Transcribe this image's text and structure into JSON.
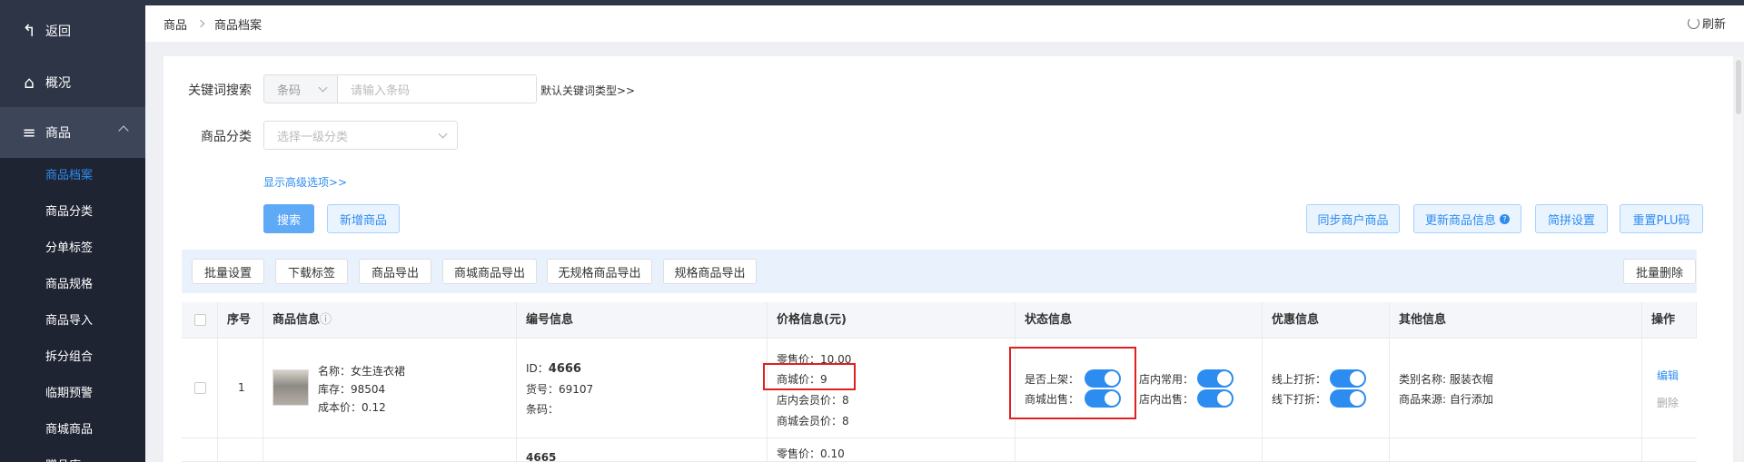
{
  "sidebar": {
    "back": "返回",
    "overview": "概况",
    "goods": "商品",
    "sub_items": [
      "商品档案",
      "商品分类",
      "分单标签",
      "商品规格",
      "商品导入",
      "拆分组合",
      "临期预警",
      "商城商品",
      "赠品库"
    ]
  },
  "breadcrumb": {
    "root": "商品",
    "current": "商品档案"
  },
  "refresh_label": "刷新",
  "search": {
    "keyword_label": "关键词搜索",
    "keyword_type": "条码",
    "keyword_placeholder": "请输入条码",
    "default_type_link": "默认关键词类型>>",
    "category_label": "商品分类",
    "category_placeholder": "选择一级分类",
    "advanced_link": "显示高级选项>>",
    "search_btn": "搜索",
    "add_btn": "新增商品"
  },
  "right_buttons": [
    "同步商户商品",
    "更新商品信息",
    "简拼设置",
    "重置PLU码"
  ],
  "toolbar": {
    "buttons": [
      "批量设置",
      "下载标签",
      "商品导出",
      "商城商品导出",
      "无规格商品导出",
      "规格商品导出"
    ],
    "batch_delete": "批量删除"
  },
  "table": {
    "headers": [
      "序号",
      "商品信息",
      "编号信息",
      "价格信息(元)",
      "状态信息",
      "优惠信息",
      "其他信息",
      "操作"
    ],
    "info_icon": "ⓘ",
    "rows": [
      {
        "index": "1",
        "name": "名称：女生连衣裙",
        "stock": "库存：98504",
        "cost": "成本价：0.12",
        "id_label": "ID：",
        "id_value": "4666",
        "sku": "货号：69107",
        "barcode": "条码：",
        "retail": "零售价：10.00",
        "mall": "商城价：9",
        "member": "店内会员价：8",
        "mall_member": "商城会员价：8",
        "on_shelf": "是否上架：",
        "mall_sale": "商城出售：",
        "store_common": "店内常用：",
        "store_sale": "店内出售：",
        "online_discount": "线上打折：",
        "offline_discount": "线下打折：",
        "category": "类别名称: 服装衣帽",
        "source": "商品来源: 自行添加",
        "edit": "编辑",
        "delete": "删除"
      },
      {
        "id_value": "4665",
        "retail": "零售价：0.10"
      }
    ]
  },
  "colors": {
    "accent": "#2d8cf0",
    "sidebar": "#2e3547",
    "highlight": "#e0201f"
  }
}
